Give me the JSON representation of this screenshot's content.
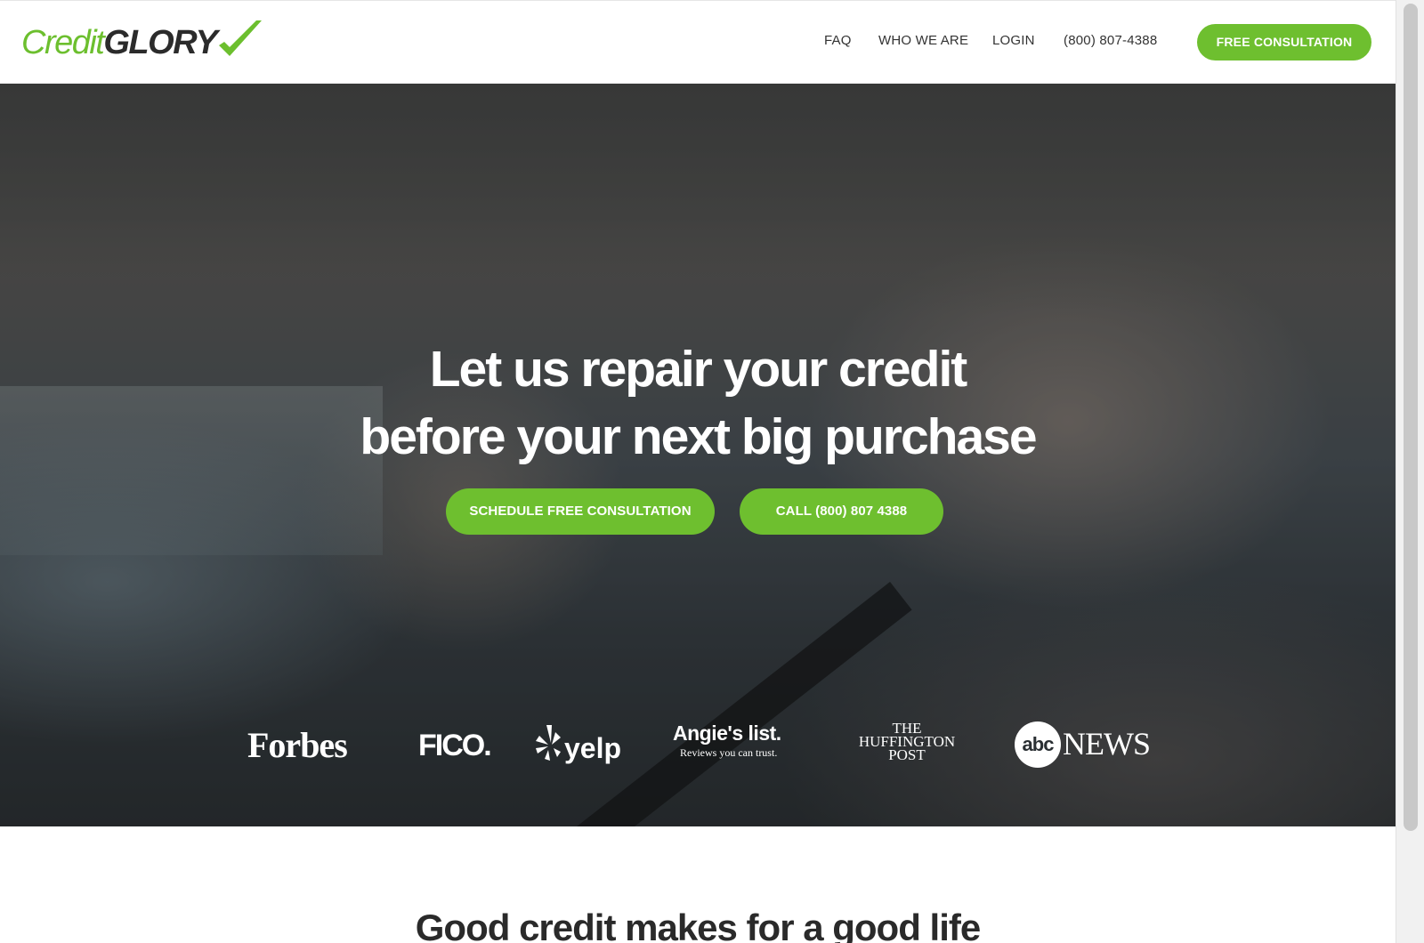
{
  "brand": {
    "logo_part1": "Credit",
    "logo_part2": "GLORY",
    "primary_color": "#6ebf2f",
    "dark_color": "#2b2b2b"
  },
  "nav": {
    "faq": "FAQ",
    "who_we_are": "WHO WE ARE",
    "login": "LOGIN",
    "phone": "(800) 807-4388",
    "cta": "FREE CONSULTATION"
  },
  "hero": {
    "headline_line1": "Let us repair your credit",
    "headline_line2": "before your next big purchase",
    "cta_primary": "SCHEDULE FREE CONSULTATION",
    "cta_secondary": "CALL (800) 807 4388"
  },
  "press_logos": {
    "forbes": "Forbes",
    "fico": "FICO.",
    "yelp": "yelp",
    "angies_title": "Angie's list.",
    "angies_tagline": "Reviews you can trust.",
    "huffington_line1": "THE",
    "huffington_line2": "HUFFINGTON",
    "huffington_line3": "POST",
    "abc_mark": "abc",
    "abc_news": "NEWS"
  },
  "section": {
    "heading": "Good credit makes for a good life"
  }
}
